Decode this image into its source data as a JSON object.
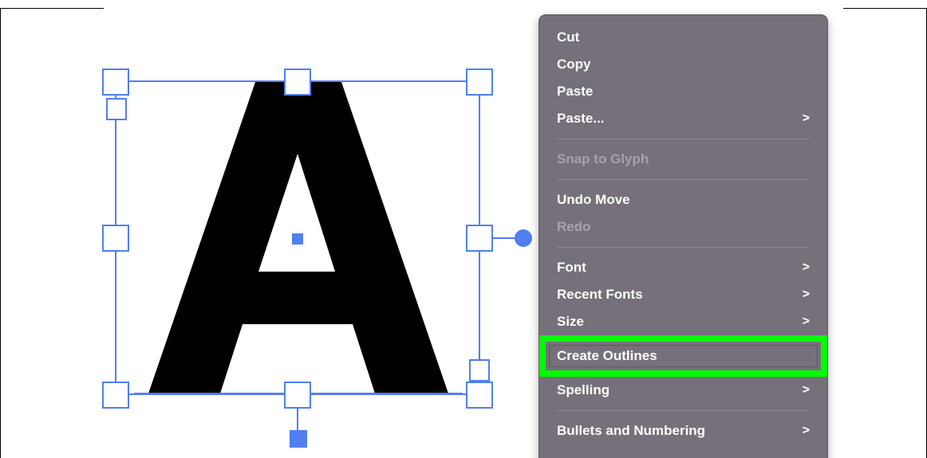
{
  "canvas": {
    "glyph": "A",
    "selection_color": "#4f7ff0",
    "glyph_color": "#000000",
    "background": "#ffffff"
  },
  "context_menu": {
    "background": "#76707a",
    "highlight_color": "#00ff00",
    "items": [
      {
        "label": "Cut",
        "enabled": true,
        "submenu": false
      },
      {
        "label": "Copy",
        "enabled": true,
        "submenu": false
      },
      {
        "label": "Paste",
        "enabled": true,
        "submenu": false
      },
      {
        "label": "Paste...",
        "enabled": true,
        "submenu": true
      },
      {
        "label": "Snap to Glyph",
        "enabled": false,
        "submenu": false
      },
      {
        "label": "Undo Move",
        "enabled": true,
        "submenu": false
      },
      {
        "label": "Redo",
        "enabled": false,
        "submenu": false
      },
      {
        "label": "Font",
        "enabled": true,
        "submenu": true
      },
      {
        "label": "Recent Fonts",
        "enabled": true,
        "submenu": true
      },
      {
        "label": "Size",
        "enabled": true,
        "submenu": true
      },
      {
        "label": "Create Outlines",
        "enabled": true,
        "submenu": false,
        "highlighted": true
      },
      {
        "label": "Spelling",
        "enabled": true,
        "submenu": true
      },
      {
        "label": "Bullets and Numbering",
        "enabled": true,
        "submenu": true
      }
    ],
    "submenu_icon": "chevron-right-icon"
  }
}
